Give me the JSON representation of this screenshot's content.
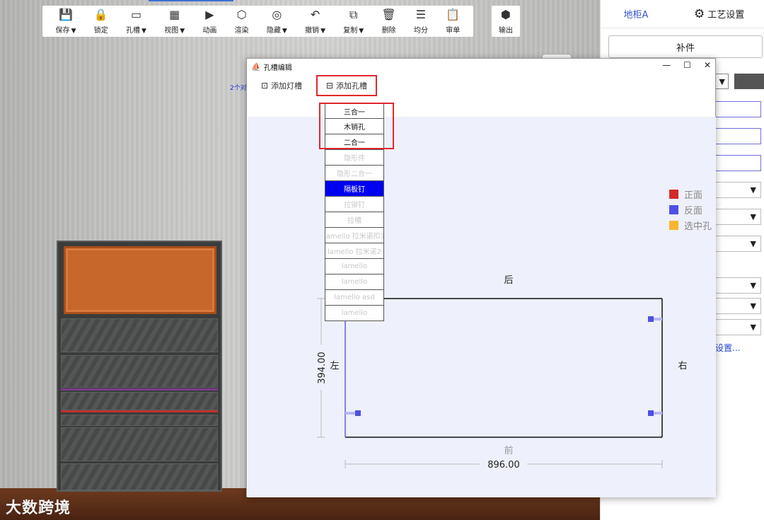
{
  "toolbar": {
    "items": [
      {
        "label": "保存",
        "icon": "save-icon",
        "glyph": "💾",
        "caret": true
      },
      {
        "label": "锁定",
        "icon": "lock-icon",
        "glyph": "🔒",
        "caret": false
      },
      {
        "label": "孔槽",
        "icon": "slot-icon",
        "glyph": "▭",
        "caret": true
      },
      {
        "label": "视图",
        "icon": "view-grid-icon",
        "glyph": "▦",
        "caret": true
      },
      {
        "label": "动画",
        "icon": "video-icon",
        "glyph": "▶",
        "caret": false
      },
      {
        "label": "渲染",
        "icon": "render-icon",
        "glyph": "⬡",
        "caret": false
      },
      {
        "label": "隐藏",
        "icon": "eye-hide-icon",
        "glyph": "◎",
        "caret": true
      },
      {
        "label": "撤销",
        "icon": "undo-icon",
        "glyph": "↶",
        "caret": true
      },
      {
        "label": "复制",
        "icon": "copy-icon",
        "glyph": "⧉",
        "caret": true
      },
      {
        "label": "删除",
        "icon": "trash-icon",
        "glyph": "🗑",
        "caret": false
      },
      {
        "label": "均分",
        "icon": "equal-split-icon",
        "glyph": "☰",
        "caret": false
      },
      {
        "label": "审单",
        "icon": "review-icon",
        "glyph": "📋",
        "caret": false
      }
    ],
    "output": {
      "label": "输出",
      "icon": "export-icon",
      "glyph": "⬢"
    },
    "caret_glyph": "▼"
  },
  "viewport": {
    "blue_label": "2个对",
    "watermark": "大数跨境"
  },
  "right_panel": {
    "tab_cabinet": "地柜A",
    "tab_process": "工艺设置",
    "add_button": "补件",
    "caret": "▼",
    "link": "设置..."
  },
  "dialog": {
    "title": "孔槽编辑",
    "controls": {
      "minimize": "—",
      "maximize": "☐",
      "close": "✕"
    },
    "add_light_slot": "添加灯槽",
    "add_hole_slot": "添加孔槽",
    "dropdown_items": [
      {
        "label": "三合一",
        "state": "enabled"
      },
      {
        "label": "木销孔",
        "state": "enabled"
      },
      {
        "label": "二合一",
        "state": "enabled"
      },
      {
        "label": "隐形件",
        "state": "disabled"
      },
      {
        "label": "隐形二合一",
        "state": "disabled"
      },
      {
        "label": "隔板钉",
        "state": "selected"
      },
      {
        "label": "拉铆钉",
        "state": "disabled"
      },
      {
        "label": "拉槽",
        "state": "disabled"
      },
      {
        "label": "lamello 拉米诺扣1",
        "state": "disabled"
      },
      {
        "label": "lamello 拉米诺2",
        "state": "disabled"
      },
      {
        "label": "lamello",
        "state": "disabled"
      },
      {
        "label": "lamello",
        "state": "disabled"
      },
      {
        "label": "lamello asd",
        "state": "disabled"
      },
      {
        "label": "lamello",
        "state": "disabled"
      }
    ],
    "legend": [
      {
        "label": "正面",
        "color": "#d42a2a"
      },
      {
        "label": "反面",
        "color": "#4f4fe6"
      },
      {
        "label": "选中孔",
        "color": "#f5b731"
      }
    ],
    "panel_drawing": {
      "label_back": "后",
      "label_front": "前",
      "label_left": "左",
      "label_right": "右",
      "width_dim": "896.00",
      "height_dim": "394.00"
    }
  },
  "colors": {
    "accent_blue": "#3355cc",
    "highlight_red": "#e0272e",
    "selected_item": "#0000f0",
    "cabinet_top": "#c8672c"
  }
}
